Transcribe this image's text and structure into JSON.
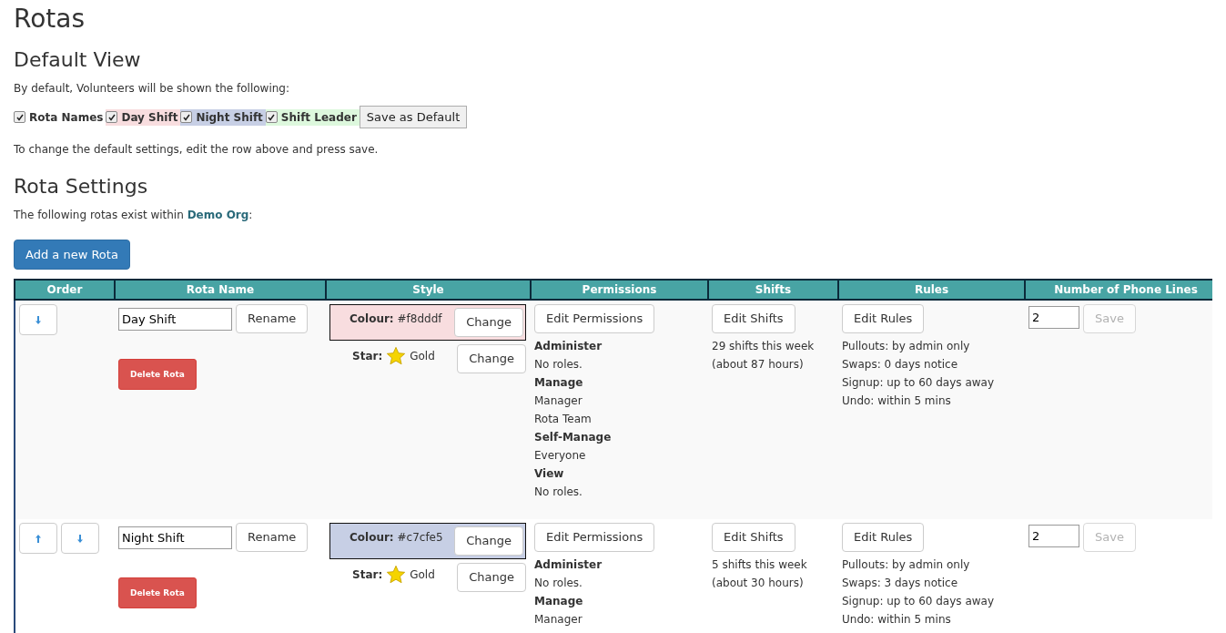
{
  "title": "Rotas",
  "default_view": {
    "heading": "Default View",
    "intro": "By default, Volunteers will be shown the following:",
    "options": [
      {
        "label": "Rota Names",
        "checked": true
      },
      {
        "label": "Day Shift",
        "checked": true,
        "color": "#f8dddf"
      },
      {
        "label": "Night Shift",
        "checked": true,
        "color": "#c7cfe5"
      },
      {
        "label": "Shift Leader",
        "checked": true,
        "color": "#ddf8dd"
      }
    ],
    "save_button": "Save as Default",
    "note": "To change the default settings, edit the row above and press save."
  },
  "rota_settings": {
    "heading": "Rota Settings",
    "intro": "The following rotas exist within **Demo Org**:",
    "add_button": "Add a new Rota"
  },
  "table": {
    "columns": [
      "Order",
      "Rota Name",
      "Style",
      "Permissions",
      "Shifts",
      "Rules",
      "Number of Phone Lines"
    ],
    "rows": [
      {
        "order_buttons": [
          {
            "kind": "down"
          }
        ],
        "name": "Day Shift",
        "rename": "Rename",
        "delete": "Delete Rota",
        "colour_label": "Colour:",
        "colour_value": "#f8dddf",
        "color": "#f8dddf",
        "colour_change": "Change",
        "star_label": "Star:",
        "star_value": "Gold",
        "star_change": "Change",
        "edit_permissions": "Edit Permissions",
        "permissions": [
          {
            "heading": "Administer",
            "roles": [
              "No roles."
            ]
          },
          {
            "heading": "Manage",
            "roles": [
              "Manager",
              "Rota Team"
            ]
          },
          {
            "heading": "Self-Manage",
            "roles": [
              "Everyone"
            ]
          },
          {
            "heading": "View",
            "roles": [
              "No roles."
            ]
          }
        ],
        "edit_shifts": "Edit Shifts",
        "shifts": [
          "29 shifts this week",
          "(about 87 hours)"
        ],
        "edit_rules": "Edit Rules",
        "rules": [
          "Pullouts: by admin only",
          "Swaps: 0 days notice",
          "Signup: up to 60 days away",
          "Undo: within 5 mins"
        ],
        "phone_lines": "2",
        "save": {
          "label": "Save",
          "disabled": true
        }
      },
      {
        "order_buttons": [
          {
            "kind": "up"
          },
          {
            "kind": "down"
          }
        ],
        "name": "Night Shift",
        "rename": "Rename",
        "delete": "Delete Rota",
        "colour_label": "Colour:",
        "colour_value": "#c7cfe5",
        "color": "#c7cfe5",
        "colour_change": "Change",
        "star_label": "Star:",
        "star_value": "Gold",
        "star_change": "Change",
        "edit_permissions": "Edit Permissions",
        "permissions": [
          {
            "heading": "Administer",
            "roles": [
              "No roles."
            ]
          },
          {
            "heading": "Manage",
            "roles": [
              "Manager"
            ]
          }
        ],
        "edit_shifts": "Edit Shifts",
        "shifts": [
          "5 shifts this week",
          "(about 30 hours)"
        ],
        "edit_rules": "Edit Rules",
        "rules": [
          "Pullouts: by admin only",
          "Swaps: 3 days notice",
          "Signup: up to 60 days away",
          "Undo: within 5 mins"
        ],
        "phone_lines": "2",
        "save": {
          "label": "Save",
          "disabled": true
        }
      }
    ]
  }
}
